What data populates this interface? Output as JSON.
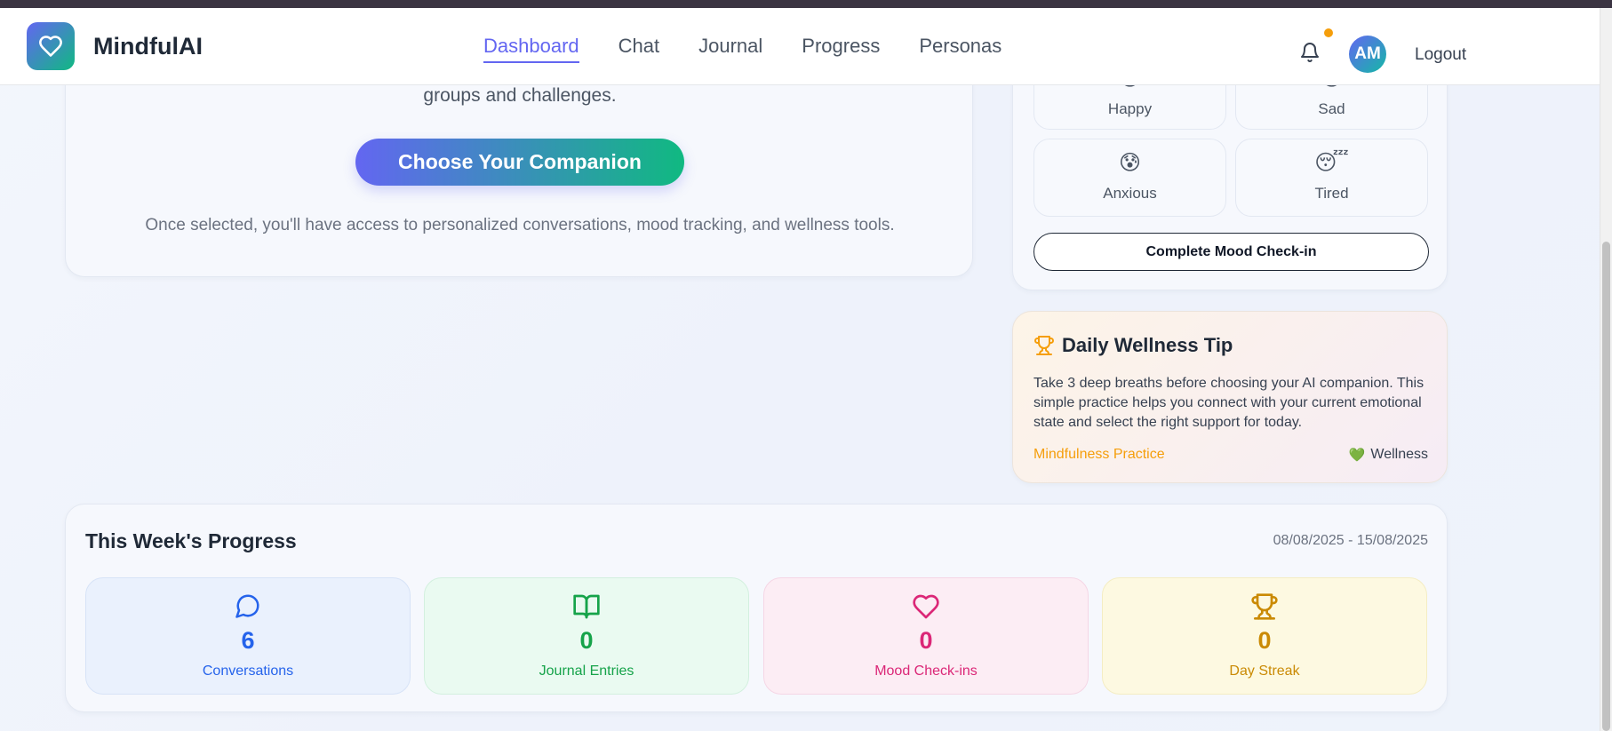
{
  "header": {
    "brand": "MindfulAI",
    "nav": [
      {
        "label": "Dashboard",
        "active": true
      },
      {
        "label": "Chat",
        "active": false
      },
      {
        "label": "Journal",
        "active": false
      },
      {
        "label": "Progress",
        "active": false
      },
      {
        "label": "Personas",
        "active": false
      }
    ],
    "avatar_initials": "AM",
    "logout_label": "Logout",
    "notification_dot_color": "#f59e0b"
  },
  "companion": {
    "subtitle_fragment": "groups and challenges.",
    "button_label": "Choose Your Companion",
    "note": "Once selected, you'll have access to personalized conversations, mood tracking, and wellness tools."
  },
  "mood": {
    "options": [
      {
        "label": "Happy",
        "emoji": "😊"
      },
      {
        "label": "Sad",
        "emoji": "😢"
      },
      {
        "label": "Anxious",
        "emoji": "😰"
      },
      {
        "label": "Tired",
        "emoji": "😴"
      }
    ],
    "checkin_label": "Complete Mood Check-in"
  },
  "tip": {
    "title": "Daily Wellness Tip",
    "body": "Take 3 deep breaths before choosing your AI companion. This simple practice helps you connect with your current emotional state and select the right support for today.",
    "category": "Mindfulness Practice",
    "tag_icon": "💚",
    "tag": "Wellness"
  },
  "progress": {
    "title": "This Week's Progress",
    "date_range": "08/08/2025 - 15/08/2025",
    "stats": [
      {
        "value": "6",
        "label": "Conversations",
        "icon": "message-circle-icon",
        "color": "#2563eb"
      },
      {
        "value": "0",
        "label": "Journal Entries",
        "icon": "book-open-icon",
        "color": "#16a34a"
      },
      {
        "value": "0",
        "label": "Mood Check-ins",
        "icon": "heart-icon",
        "color": "#db2777"
      },
      {
        "value": "0",
        "label": "Day Streak",
        "icon": "trophy-icon",
        "color": "#ca8a04"
      }
    ]
  },
  "colors": {
    "accent": "#6366f1",
    "accent_secondary": "#10b981"
  }
}
